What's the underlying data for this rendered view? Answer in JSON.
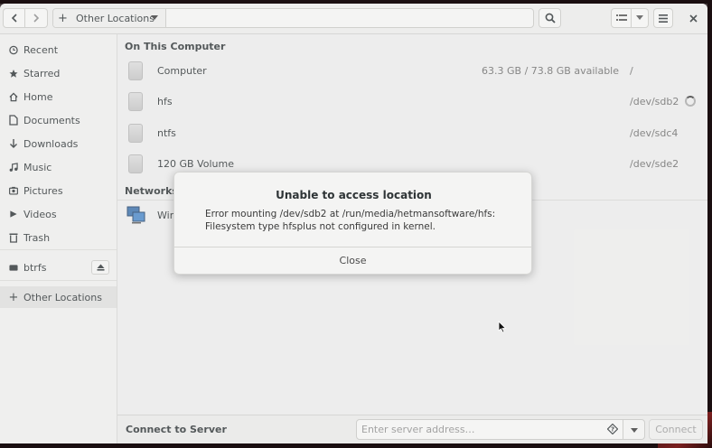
{
  "headerbar": {
    "location_label": "Other Locations",
    "icons": [
      "go-back-icon",
      "go-forward-icon",
      "plus-icon",
      "dropdown-icon",
      "search-icon",
      "list-view-icon",
      "view-options-icon",
      "menu-icon",
      "close-icon"
    ]
  },
  "sidebar": {
    "items": [
      {
        "label": "Recent",
        "icon": "clock-icon"
      },
      {
        "label": "Starred",
        "icon": "star-icon"
      },
      {
        "label": "Home",
        "icon": "home-icon"
      },
      {
        "label": "Documents",
        "icon": "document-icon"
      },
      {
        "label": "Downloads",
        "icon": "download-icon"
      },
      {
        "label": "Music",
        "icon": "music-icon"
      },
      {
        "label": "Pictures",
        "icon": "picture-icon"
      },
      {
        "label": "Videos",
        "icon": "video-icon"
      },
      {
        "label": "Trash",
        "icon": "trash-icon"
      }
    ],
    "mounts": [
      {
        "label": "btrfs",
        "icon": "drive-icon"
      }
    ],
    "other_locations": {
      "label": "Other Locations",
      "icon": "plus-icon"
    }
  },
  "main": {
    "on_this_computer_title": "On This Computer",
    "drives": [
      {
        "name": "Computer",
        "capacity": "63.3 GB / 73.8 GB available",
        "path": "/"
      },
      {
        "name": "hfs",
        "capacity": "",
        "path": "/dev/sdb2"
      },
      {
        "name": "ntfs",
        "capacity": "",
        "path": "/dev/sdc4"
      },
      {
        "name": "120 GB Volume",
        "capacity": "",
        "path": "/dev/sde2"
      }
    ],
    "networks_title": "Networks",
    "network_item": "Win"
  },
  "footer": {
    "label": "Connect to Server",
    "server_placeholder": "Enter server address…",
    "connect_label": "Connect"
  },
  "dialog": {
    "title": "Unable to access location",
    "message": "Error mounting /dev/sdb2 at /run/media/hetmansoftware/hfs: Filesystem type hfsplus not configured in kernel.",
    "close_label": "Close"
  }
}
